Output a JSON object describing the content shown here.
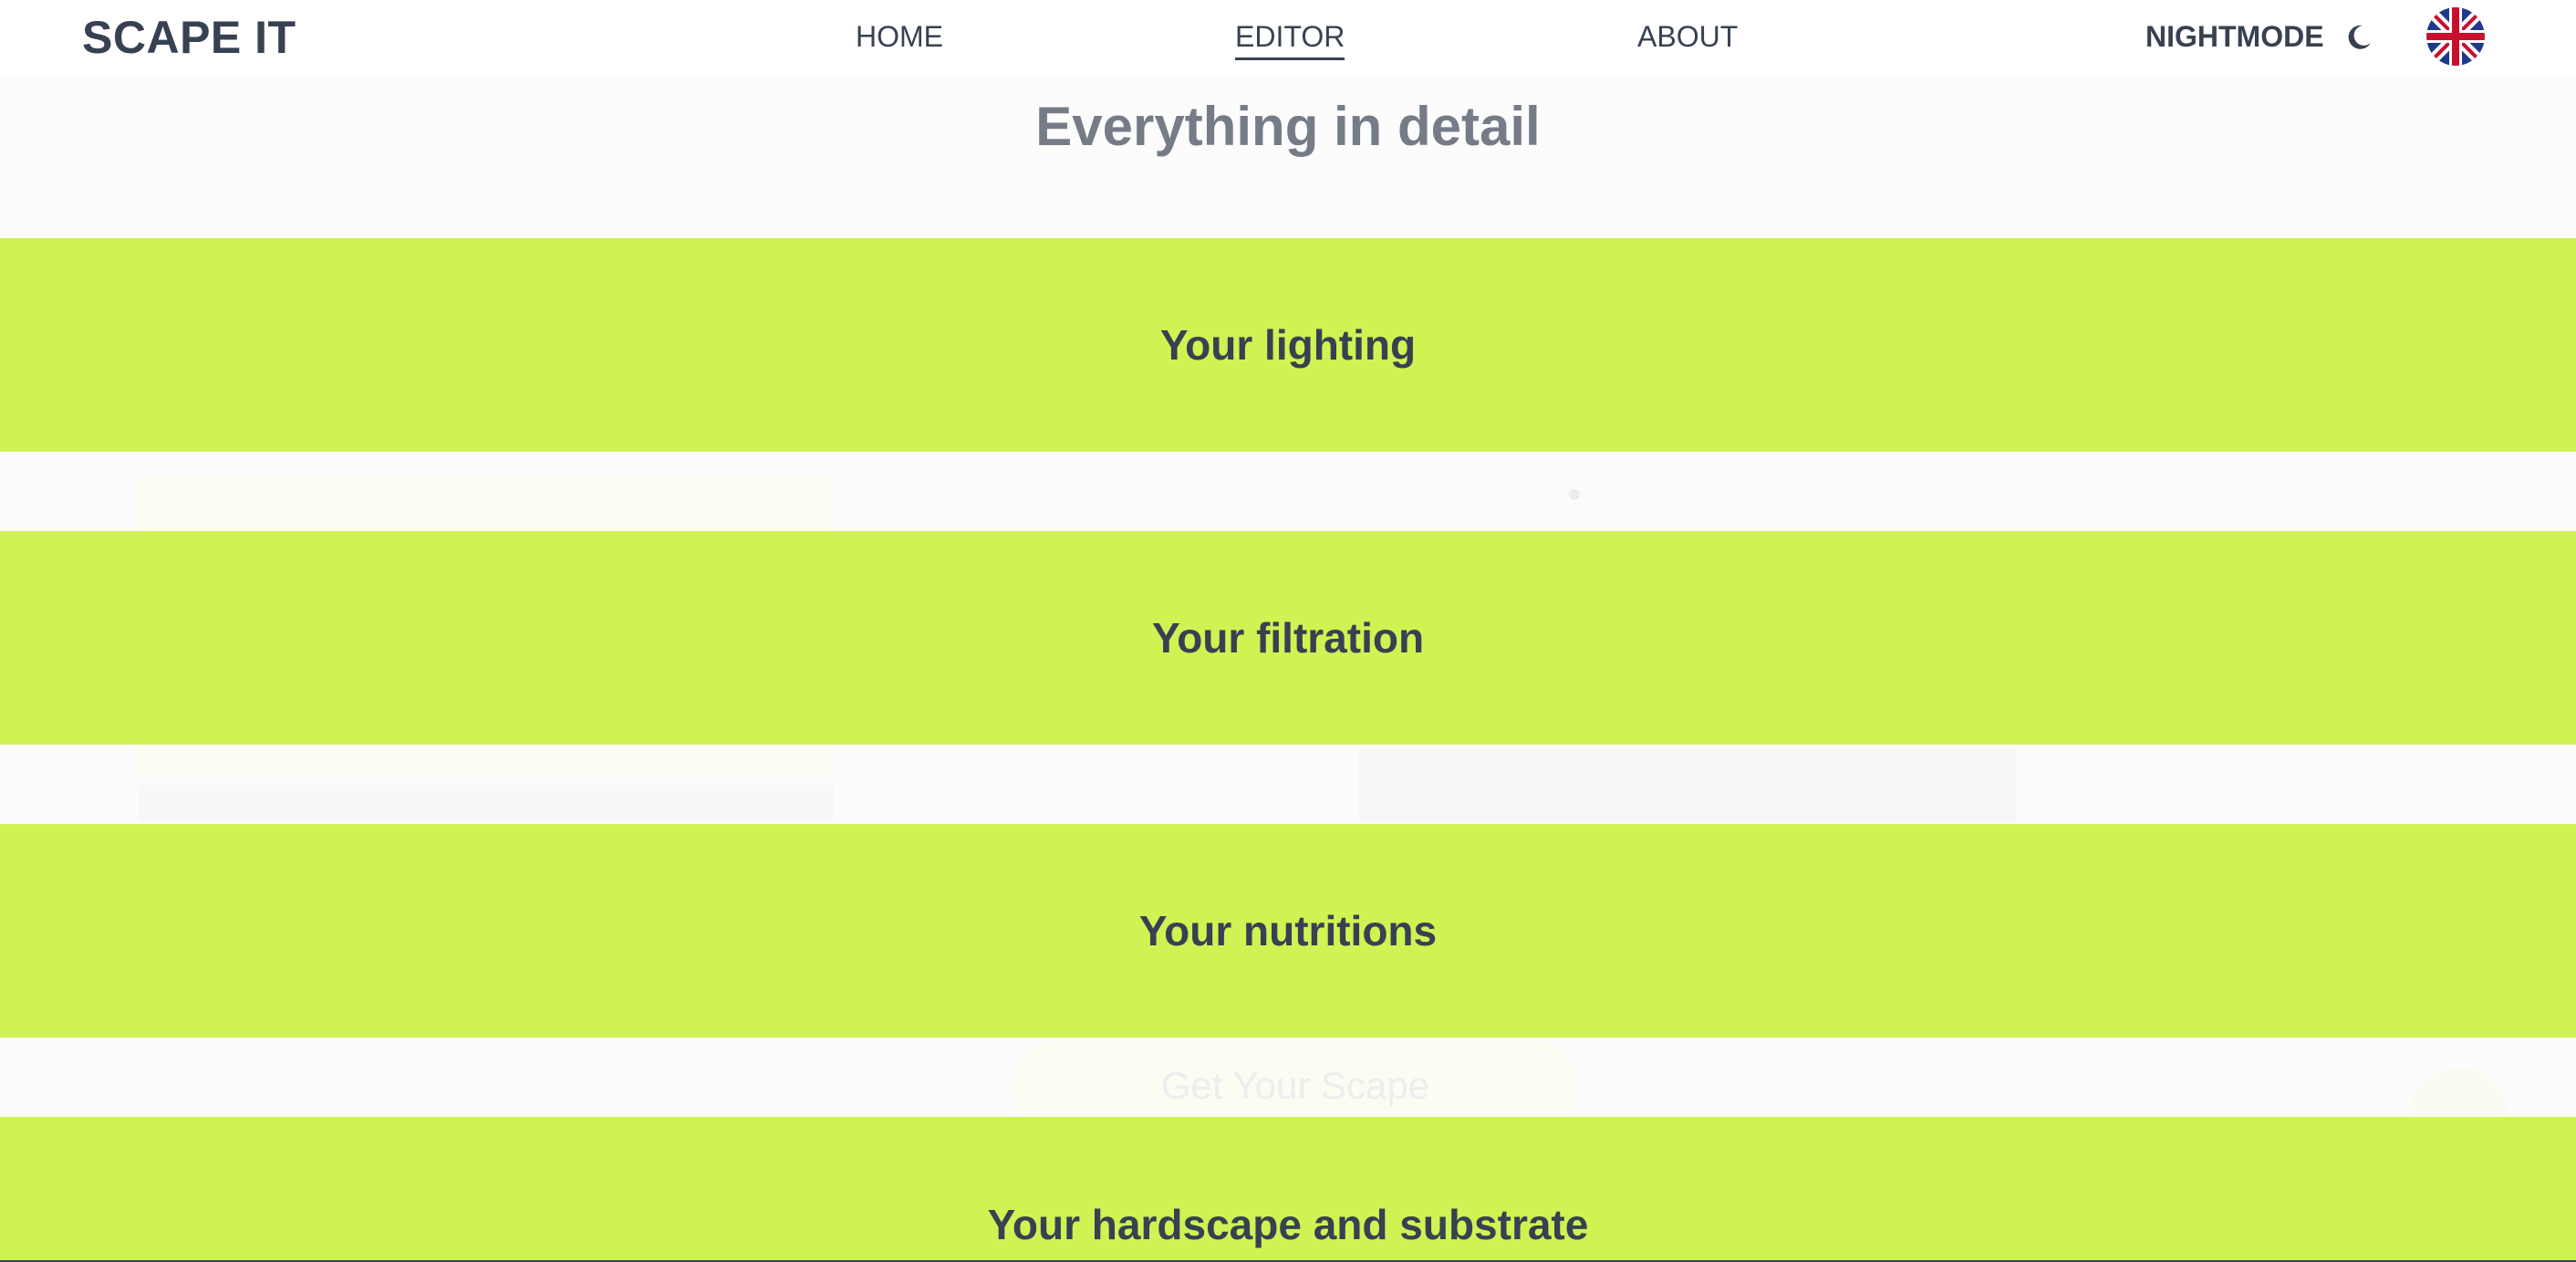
{
  "header": {
    "logo": "SCAPE IT",
    "nav": {
      "home": "HOME",
      "editor": "EDITOR",
      "about": "ABOUT"
    },
    "active_nav": "EDITOR",
    "nightmode_label": "NIGHTMODE",
    "nightmode_icon": "moon-icon",
    "language_icon": "uk-flag-icon"
  },
  "main": {
    "title": "Everything in detail",
    "ghost_button": "Get Your Scape",
    "sections": [
      {
        "label": "Your lighting"
      },
      {
        "label": "Your filtration"
      },
      {
        "label": "Your nutritions"
      },
      {
        "label": "Your hardscape and substrate"
      }
    ]
  },
  "colors": {
    "accent": "#cff353",
    "text": "#374151",
    "title": "#767c87",
    "background": "#ffffff"
  }
}
